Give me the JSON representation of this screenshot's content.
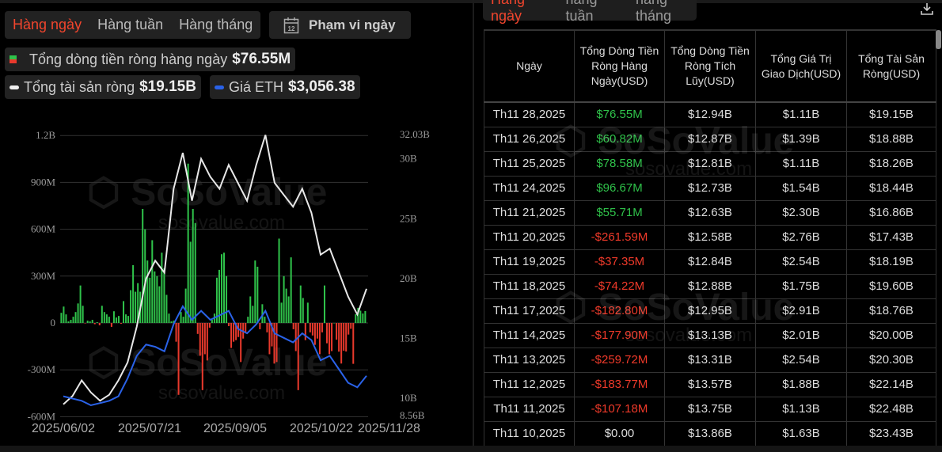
{
  "left": {
    "tabs": [
      {
        "label": "Hàng ngày",
        "active": true
      },
      {
        "label": "Hàng tuần"
      },
      {
        "label": "Hàng tháng"
      }
    ],
    "date_range_label": "Phạm vi ngày",
    "calendar_icon_day": "12",
    "legend": {
      "daily_net_inflow_label": "Tổng dòng tiền ròng hàng ngày",
      "daily_net_inflow_value": "$76.55M",
      "net_assets_label": "Tổng tài sản ròng",
      "net_assets_value": "$19.15B",
      "eth_price_label": "Giá ETH",
      "eth_price_value": "$3,056.38"
    },
    "watermark": {
      "brand": "SoSoValue",
      "url": "sosovalue.com"
    }
  },
  "chart_data": {
    "type": "bar+line",
    "x_tick_labels": [
      "2025/06/02",
      "2025/07/21",
      "2025/09/05",
      "2025/10/22",
      "2025/11/28"
    ],
    "x_range": [
      "2025/06/02",
      "2025/11/28"
    ],
    "left_axis": {
      "tick_labels": [
        "1.2B",
        "900M",
        "600M",
        "300M",
        "0",
        "-300M",
        "-600M"
      ],
      "range_usd_millions": [
        -600,
        1200
      ]
    },
    "right_axis": {
      "tick_labels": [
        "32.03B",
        "30B",
        "25B",
        "20B",
        "15B",
        "10B",
        "8.56B"
      ],
      "range_usd_billions": [
        8.56,
        32.03
      ]
    },
    "grid": true,
    "colors": {
      "inflow": "#2fc24a",
      "outflow": "#e8392c",
      "net_assets": "#e8e8e8",
      "eth_price": "#2a62e8"
    },
    "series": [
      {
        "name": "Tổng dòng tiền ròng hàng ngày",
        "unit": "USD millions",
        "axis": "left",
        "type": "bar",
        "values": [
          65,
          105,
          55,
          10,
          20,
          40,
          70,
          125,
          240,
          110,
          -3,
          15,
          10,
          20,
          -8,
          5,
          -15,
          110,
          70,
          55,
          40,
          -25,
          75,
          35,
          45,
          -5,
          140,
          55,
          45,
          210,
          370,
          200,
          255,
          200,
          730,
          600,
          400,
          290,
          530,
          330,
          300,
          235,
          450,
          350,
          180,
          60,
          10,
          15,
          -120,
          -460,
          70,
          40,
          220,
          1020,
          520,
          730,
          640,
          -70,
          -210,
          -430,
          -200,
          -240,
          -30,
          20,
          60,
          290,
          340,
          440,
          450,
          300,
          -20,
          -160,
          -120,
          -110,
          -90,
          -250,
          -100,
          -60,
          40,
          170,
          110,
          400,
          360,
          -40,
          120,
          40,
          -60,
          -200,
          -150,
          -260,
          -250,
          540,
          130,
          300,
          220,
          170,
          420,
          -40,
          -180,
          -430,
          240,
          160,
          -110,
          130,
          -60,
          -80,
          -140,
          -100,
          -200,
          -60,
          240,
          -130,
          -200,
          -180,
          0,
          -107.18,
          -183.77,
          -259.72,
          -177.9,
          -182.8,
          -74.22,
          -37.35,
          -261.59,
          55.71,
          96.67,
          78.58,
          60.82,
          76.55
        ]
      },
      {
        "name": "Tổng tài sản ròng",
        "unit": "USD billions",
        "axis": "right",
        "type": "line",
        "values": [
          9.5,
          10.2,
          11.5,
          10.5,
          9.8,
          10.3,
          11.5,
          13,
          16,
          20,
          21.5,
          20.5,
          27.5,
          30.5,
          26.5,
          30,
          28.5,
          27.5,
          29.5,
          28,
          26.5,
          29.5,
          32,
          28,
          27,
          26,
          27.5,
          25.5,
          22,
          22.5,
          20.5,
          18.5,
          17,
          19.15
        ]
      },
      {
        "name": "Giá ETH",
        "unit": "USD",
        "type": "line",
        "values": [
          2600,
          2550,
          2500,
          2400,
          2450,
          2500,
          2600,
          3000,
          3500,
          3750,
          3700,
          3600,
          4200,
          4600,
          4300,
          4500,
          4300,
          4400,
          4500,
          4100,
          4000,
          4200,
          4500,
          4000,
          3900,
          3800,
          4000,
          3850,
          3400,
          3500,
          3200,
          2900,
          2800,
          3056.38
        ]
      }
    ]
  },
  "right": {
    "tabs": [
      {
        "label": "Hằng ngày",
        "active": true
      },
      {
        "label": "hằng tuần"
      },
      {
        "label": "hằng tháng"
      }
    ],
    "table": {
      "headers": [
        "Ngày",
        "Tổng Dòng Tiền Ròng Hàng Ngày(USD)",
        "Tổng Dòng Tiền Ròng Tích Lũy(USD)",
        "Tổng Giá Trị Giao Dịch(USD)",
        "Tổng Tài Sản Ròng(USD)"
      ],
      "rows": [
        [
          "Th11 28,2025",
          "$76.55M",
          "$12.94B",
          "$1.11B",
          "$19.15B"
        ],
        [
          "Th11 26,2025",
          "$60.82M",
          "$12.87B",
          "$1.39B",
          "$18.88B"
        ],
        [
          "Th11 25,2025",
          "$78.58M",
          "$12.81B",
          "$1.11B",
          "$18.26B"
        ],
        [
          "Th11 24,2025",
          "$96.67M",
          "$12.73B",
          "$1.54B",
          "$18.44B"
        ],
        [
          "Th11 21,2025",
          "$55.71M",
          "$12.63B",
          "$2.30B",
          "$16.86B"
        ],
        [
          "Th11 20,2025",
          "-$261.59M",
          "$12.58B",
          "$2.76B",
          "$17.43B"
        ],
        [
          "Th11 19,2025",
          "-$37.35M",
          "$12.84B",
          "$2.54B",
          "$18.19B"
        ],
        [
          "Th11 18,2025",
          "-$74.22M",
          "$12.88B",
          "$1.75B",
          "$19.60B"
        ],
        [
          "Th11 17,2025",
          "-$182.80M",
          "$12.95B",
          "$2.91B",
          "$18.76B"
        ],
        [
          "Th11 14,2025",
          "-$177.90M",
          "$13.13B",
          "$2.01B",
          "$20.00B"
        ],
        [
          "Th11 13,2025",
          "-$259.72M",
          "$13.31B",
          "$2.54B",
          "$20.30B"
        ],
        [
          "Th11 12,2025",
          "-$183.77M",
          "$13.57B",
          "$1.88B",
          "$22.14B"
        ],
        [
          "Th11 11,2025",
          "-$107.18M",
          "$13.75B",
          "$1.13B",
          "$22.48B"
        ],
        [
          "Th11 10,2025",
          "$0.00",
          "$13.86B",
          "$1.63B",
          "$23.43B"
        ]
      ]
    }
  }
}
